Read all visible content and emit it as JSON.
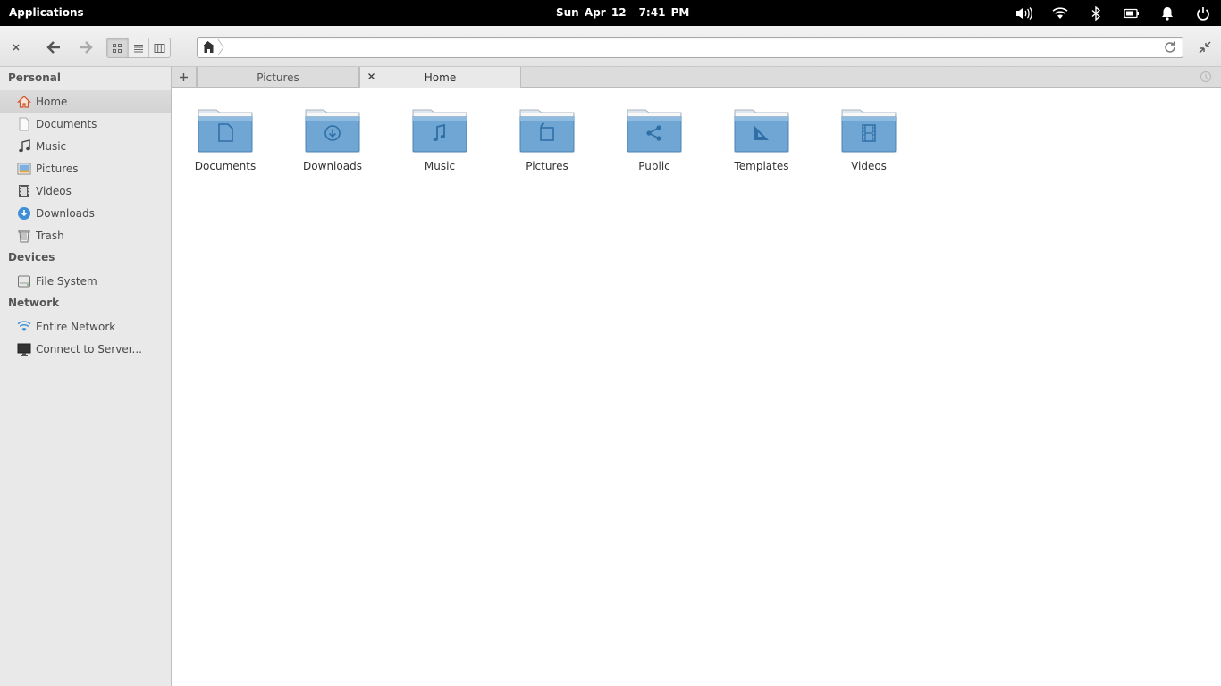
{
  "panel": {
    "applications": "Applications",
    "date": "Sun Apr 12",
    "time": "7:41 PM"
  },
  "pathbar": {
    "value": ""
  },
  "sidebar": {
    "sections": {
      "personal": "Personal",
      "devices": "Devices",
      "network": "Network"
    },
    "personal_items": [
      {
        "label": "Home",
        "icon": "home-icon"
      },
      {
        "label": "Documents",
        "icon": "document-icon"
      },
      {
        "label": "Music",
        "icon": "music-icon"
      },
      {
        "label": "Pictures",
        "icon": "pictures-icon"
      },
      {
        "label": "Videos",
        "icon": "video-icon"
      },
      {
        "label": "Downloads",
        "icon": "download-icon"
      },
      {
        "label": "Trash",
        "icon": "trash-icon"
      }
    ],
    "device_items": [
      {
        "label": "File System",
        "icon": "drive-icon"
      }
    ],
    "network_items": [
      {
        "label": "Entire Network",
        "icon": "network-icon"
      },
      {
        "label": "Connect to Server...",
        "icon": "monitor-icon"
      }
    ]
  },
  "tabs": [
    {
      "label": "Pictures"
    },
    {
      "label": "Home"
    }
  ],
  "folders": [
    {
      "label": "Documents",
      "icon": "document-icon"
    },
    {
      "label": "Downloads",
      "icon": "download-icon"
    },
    {
      "label": "Music",
      "icon": "music-icon"
    },
    {
      "label": "Pictures",
      "icon": "pictures-icon"
    },
    {
      "label": "Public",
      "icon": "share-icon"
    },
    {
      "label": "Templates",
      "icon": "set-square-icon"
    },
    {
      "label": "Videos",
      "icon": "film-icon"
    }
  ],
  "colors": {
    "folder_blue": "#6fa6d4",
    "folder_dark": "#4a82b4",
    "sidebar_bg": "#e9e9e9"
  }
}
